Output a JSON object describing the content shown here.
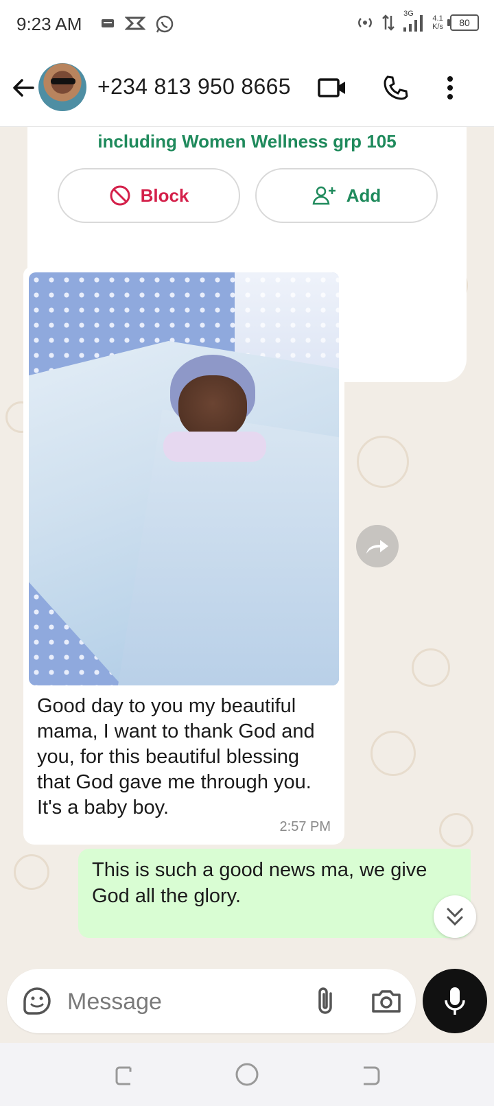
{
  "status_bar": {
    "time": "9:23 AM",
    "network_type": "3G",
    "speed_value": "4.1",
    "speed_unit": "K/s",
    "battery": "80"
  },
  "header": {
    "contact": "+234 813 950 8665"
  },
  "safety_card": {
    "groups_text": "including Women Wellness grp 105",
    "block_label": "Block",
    "add_label": "Add"
  },
  "messages": [
    {
      "direction": "incoming",
      "has_image": true,
      "text": "Good day to you my beautiful mama, I want to thank God and you, for this beautiful blessing that God gave me through you. It's a baby boy.",
      "time": "2:57 PM"
    },
    {
      "direction": "outgoing",
      "text": "This is such a good news ma, we give God all the glory."
    }
  ],
  "composer": {
    "placeholder": "Message"
  },
  "colors": {
    "accent_green": "#1f8a5c",
    "block_red": "#d4204a",
    "outgoing_bubble": "#d9fdd3",
    "chat_background": "#f2ede6"
  }
}
